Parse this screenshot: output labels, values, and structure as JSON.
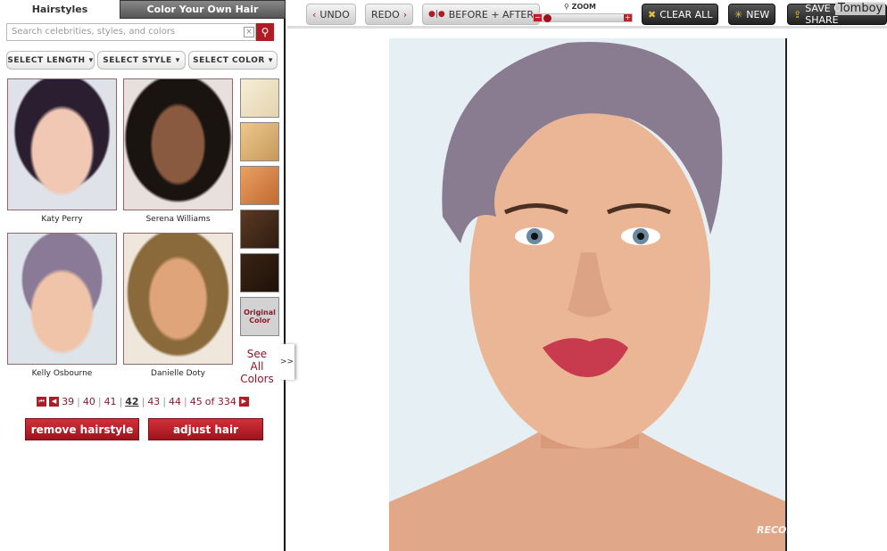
{
  "tabs": {
    "hairstyles": "Hairstyles",
    "color": "Color Your Own Hair"
  },
  "search": {
    "placeholder": "Search celebrities, styles, and colors",
    "clear": "☒",
    "icon": "search-icon"
  },
  "filters": [
    {
      "label": "SELECT LENGTH"
    },
    {
      "label": "SELECT STYLE"
    },
    {
      "label": "SELECT COLOR"
    }
  ],
  "celebrities": [
    {
      "name": "Katy Perry"
    },
    {
      "name": "Serena Williams"
    },
    {
      "name": "Kelly Osbourne"
    },
    {
      "name": "Danielle Doty"
    }
  ],
  "swatches": [
    {
      "color": "#efe4c8"
    },
    {
      "color": "#ddb27a"
    },
    {
      "color": "#d98a4c"
    },
    {
      "color": "#4a2e1c"
    },
    {
      "color": "#2e1c10"
    },
    {
      "label": "Original Color",
      "color": "#d2d2d2"
    }
  ],
  "see_all": "See All Colors",
  "more": ">>",
  "pager": {
    "pages": [
      "39",
      "40",
      "41",
      "42",
      "43",
      "44",
      "45"
    ],
    "current": "42",
    "of": "of 334"
  },
  "actions": {
    "remove": "remove hairstyle",
    "adjust": "adjust hair"
  },
  "toolbar": {
    "undo": "UNDO",
    "redo": "REDO",
    "before_after": "BEFORE + AFTER",
    "zoom": "ZOOM",
    "zoom_level": 0.1,
    "clear": "CLEAR ALL",
    "new": "NEW",
    "save": "SAVE OR SHARE"
  },
  "overlay_label": "Tomboy",
  "watermark": "RECOMMEND.RU"
}
